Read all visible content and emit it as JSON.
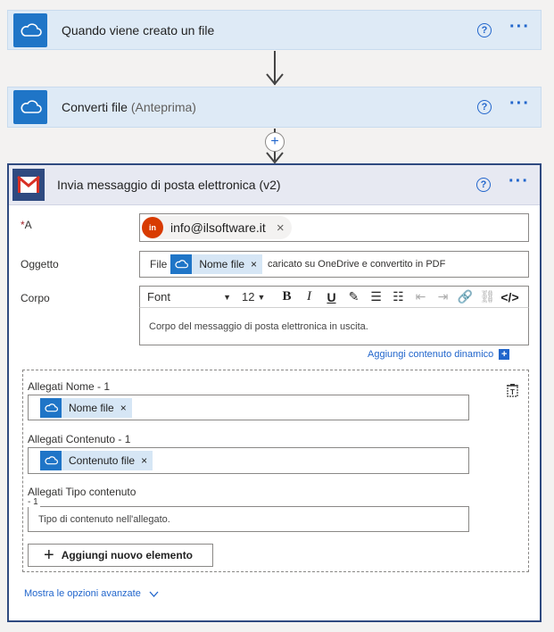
{
  "step1": {
    "title": "Quando viene creato un file",
    "icon": "onedrive-icon"
  },
  "step2": {
    "title": "Converti file",
    "subtitle": "(Anteprima)",
    "icon": "onedrive-icon"
  },
  "step3": {
    "title": "Invia messaggio di posta elettronica (v2)",
    "icon": "gmail-icon",
    "to_label": "A",
    "to_required": "*",
    "to_avatar": "in",
    "to_value": "info@ilsoftware.it",
    "subject_label": "Oggetto",
    "subject_prefix": "File",
    "subject_token": "Nome file",
    "subject_suffix": "caricato su OneDrive e convertito in PDF",
    "body_label": "Corpo",
    "font_select": "Font",
    "size_select": "12",
    "body_placeholder": "Corpo del messaggio di posta elettronica in uscita.",
    "add_dynamic": "Aggiungi contenuto dinamico",
    "att_name_label": "Allegati Nome - 1",
    "att_name_token": "Nome file",
    "att_content_label": "Allegati Contenuto - 1",
    "att_content_token": "Contenuto file",
    "att_type_label": "Allegati Tipo contenuto",
    "att_type_label2": "- 1",
    "att_type_placeholder": "Tipo di contenuto nell'allegato.",
    "add_item": "Aggiungi nuovo elemento",
    "advanced": "Mostra le opzioni avanzate"
  },
  "help_glyph": "?",
  "more_glyph": "···",
  "close_glyph": "×",
  "colors": {
    "accent": "#2266cc",
    "onedrive": "#1f75c7",
    "gmail_header": "#2f4a80"
  }
}
